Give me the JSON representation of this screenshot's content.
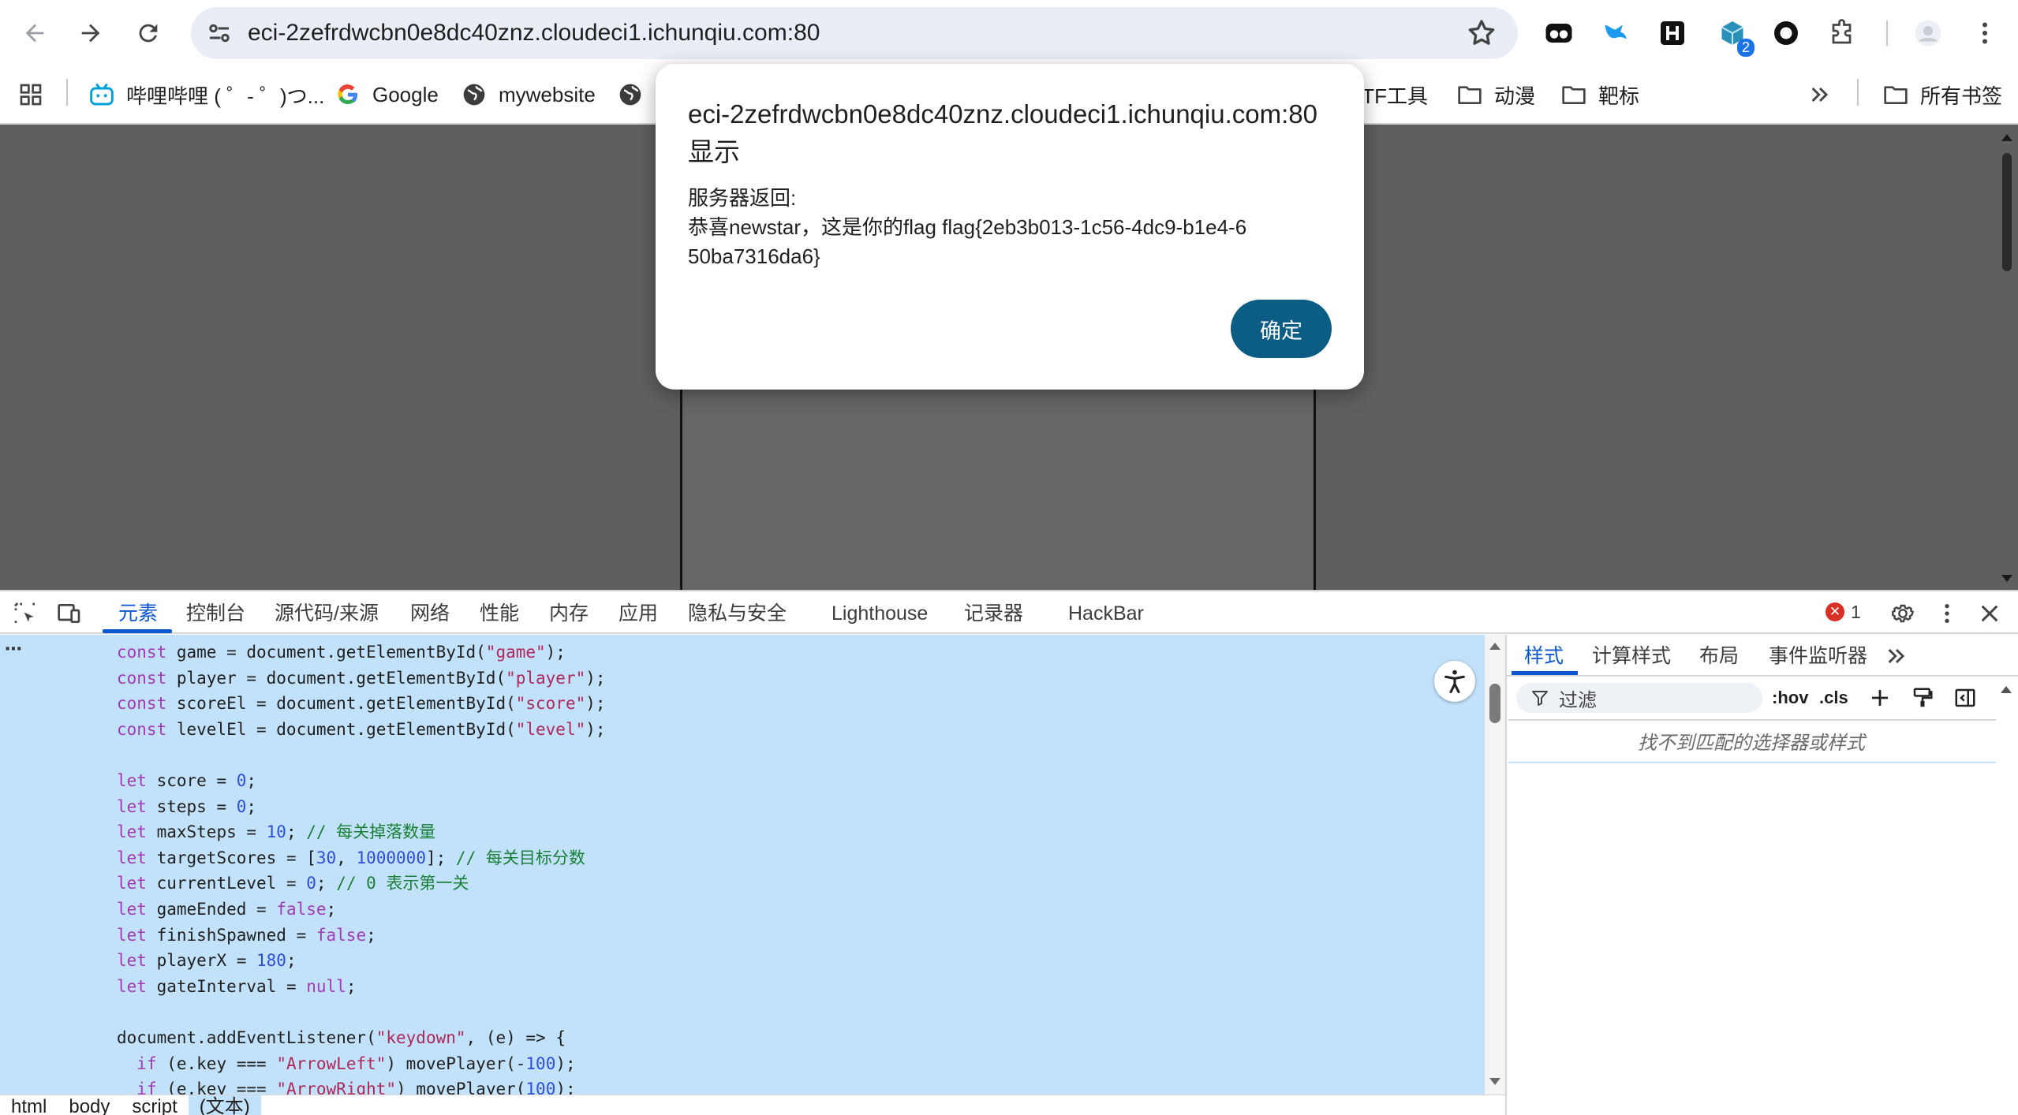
{
  "browser": {
    "url": "eci-2zefrdwcbn0e8dc40znz.cloudeci1.ichunqiu.com:80",
    "extension_badge": "2",
    "bookmarks": [
      {
        "label": "哔哩哔哩 ( ゜- ゜)つ...",
        "icon": "bilibili-icon"
      },
      {
        "label": "Google",
        "icon": "google-icon"
      },
      {
        "label": "mywebsite",
        "icon": "globe-icon"
      },
      {
        "label": "",
        "icon": "globe-icon"
      },
      {
        "label": "CTF工具",
        "icon": "folder-icon"
      },
      {
        "label": "动漫",
        "icon": "folder-icon"
      },
      {
        "label": "靶标",
        "icon": "folder-icon"
      }
    ],
    "all_bookmarks": "所有书签"
  },
  "dialog": {
    "title": "eci-2zefrdwcbn0e8dc40znz.cloudeci1.ichunqiu.com:80 显示",
    "line1": "服务器返回:",
    "line2": "恭喜newstar，这是你的flag flag{2eb3b013-1c56-4dc9-b1e4-650ba7316da6}",
    "ok_label": "确定"
  },
  "devtools": {
    "tabs": [
      "元素",
      "控制台",
      "源代码/来源",
      "网络",
      "性能",
      "内存",
      "应用",
      "隐私与安全",
      "Lighthouse",
      "记录器",
      "HackBar"
    ],
    "error_count": "1",
    "side_tabs": [
      "样式",
      "计算样式",
      "布局",
      "事件监听器"
    ],
    "filter_placeholder": "过滤",
    "hov_label": ":hov",
    "cls_label": ".cls",
    "no_match": "找不到匹配的选择器或样式",
    "breadcrumbs": [
      "html",
      "body",
      "script",
      "(文本)"
    ],
    "code_lines": [
      "const game = document.getElementById(\"game\");",
      "const player = document.getElementById(\"player\");",
      "const scoreEl = document.getElementById(\"score\");",
      "const levelEl = document.getElementById(\"level\");",
      "",
      "let score = 0;",
      "let steps = 0;",
      "let maxSteps = 10; // 每关掉落数量",
      "let targetScores = [30, 1000000]; // 每关目标分数",
      "let currentLevel = 0; // 0 表示第一关",
      "let gameEnded = false;",
      "let finishSpawned = false;",
      "let playerX = 180;",
      "let gateInterval = null;",
      "",
      "document.addEventListener(\"keydown\", (e) => {",
      "  if (e.key === \"ArrowLeft\") movePlayer(-100);",
      "  if (e.key === \"ArrowRight\") movePlayer(100);"
    ]
  },
  "colors": {
    "accent": "#0b57d0",
    "dialog_button": "#0b5d86",
    "selection": "#c2e2fb",
    "page_background": "#5f5f5f"
  }
}
